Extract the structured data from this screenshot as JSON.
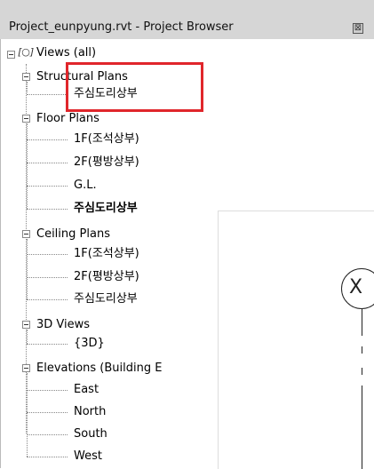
{
  "window": {
    "title": "Project_eunpyung.rvt - Project Browser",
    "close_symbol": "⊠"
  },
  "tree": {
    "root": {
      "icon": "views-icon",
      "label": "Views (all)"
    },
    "groups": [
      {
        "label": "Structural Plans",
        "items": [
          "주심도리상부"
        ]
      },
      {
        "label": "Floor Plans",
        "items": [
          "1F(조석상부)",
          "2F(평방상부)",
          "G.L.",
          "주심도리상부"
        ]
      },
      {
        "label": "Ceiling Plans",
        "items": [
          "1F(조석상부)",
          "2F(평방상부)",
          "주심도리상부"
        ]
      },
      {
        "label": "3D Views",
        "items": [
          "{3D}"
        ]
      },
      {
        "label": "Elevations (Building E",
        "items": [
          "East",
          "North",
          "South",
          "West"
        ]
      }
    ]
  },
  "canvas": {
    "grid_bubble_label": "X"
  },
  "colors": {
    "highlight": "#e0262b",
    "titlebar": "#d6d6d6"
  }
}
